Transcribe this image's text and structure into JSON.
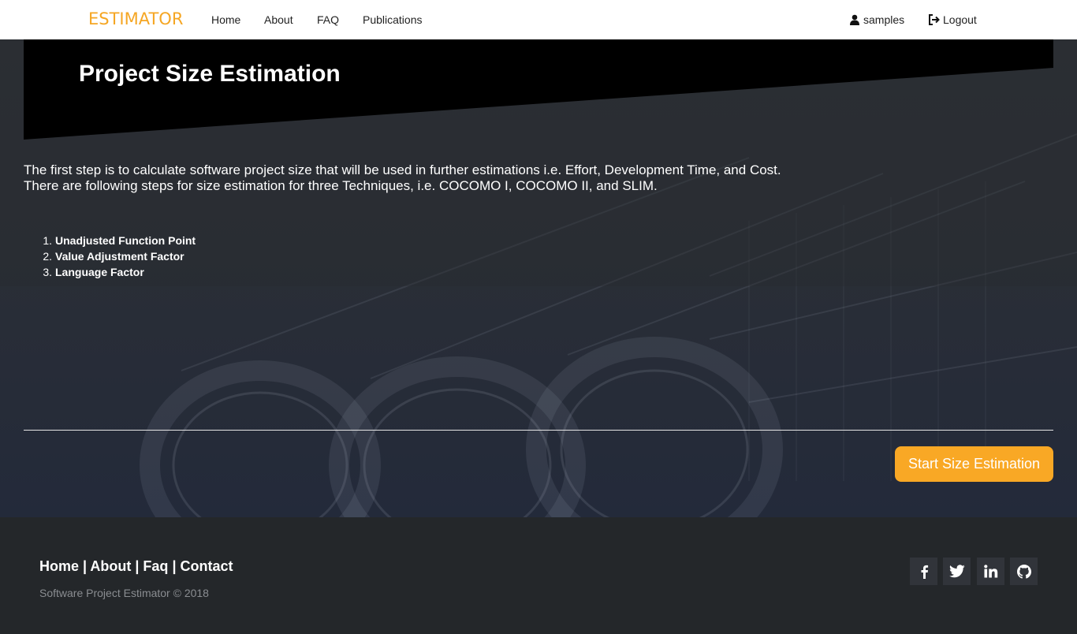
{
  "navbar": {
    "logo_text": "ESTIMATOR",
    "links": [
      "Home",
      "About",
      "FAQ",
      "Publications"
    ],
    "user": "samples",
    "logout": "Logout"
  },
  "hero": {
    "title": "Project Size Estimation",
    "intro_line1": "The first step is to calculate software project size that will be used in further estimations i.e. Effort, Development Time, and Cost.",
    "intro_line2": "There are following steps for size estimation for three Techniques, i.e. COCOMO I, COCOMO II, and SLIM.",
    "steps": [
      {
        "num": "1.",
        "label": "Unadjusted Function Point"
      },
      {
        "num": "2.",
        "label": "Value Adjustment Factor"
      },
      {
        "num": "3.",
        "label": "Language Factor"
      }
    ],
    "start_button": "Start Size Estimation"
  },
  "footer": {
    "links": [
      "Home",
      "About",
      "Faq",
      "Contact"
    ],
    "separator": " | ",
    "copyright": "Software Project Estimator © 2018",
    "social_icons": [
      "facebook-icon",
      "twitter-icon",
      "linkedin-icon",
      "github-icon"
    ]
  },
  "colors": {
    "accent": "#f9a825",
    "logo": "#f5a623",
    "banner": "#000000",
    "footer_bg": "#24272a"
  }
}
